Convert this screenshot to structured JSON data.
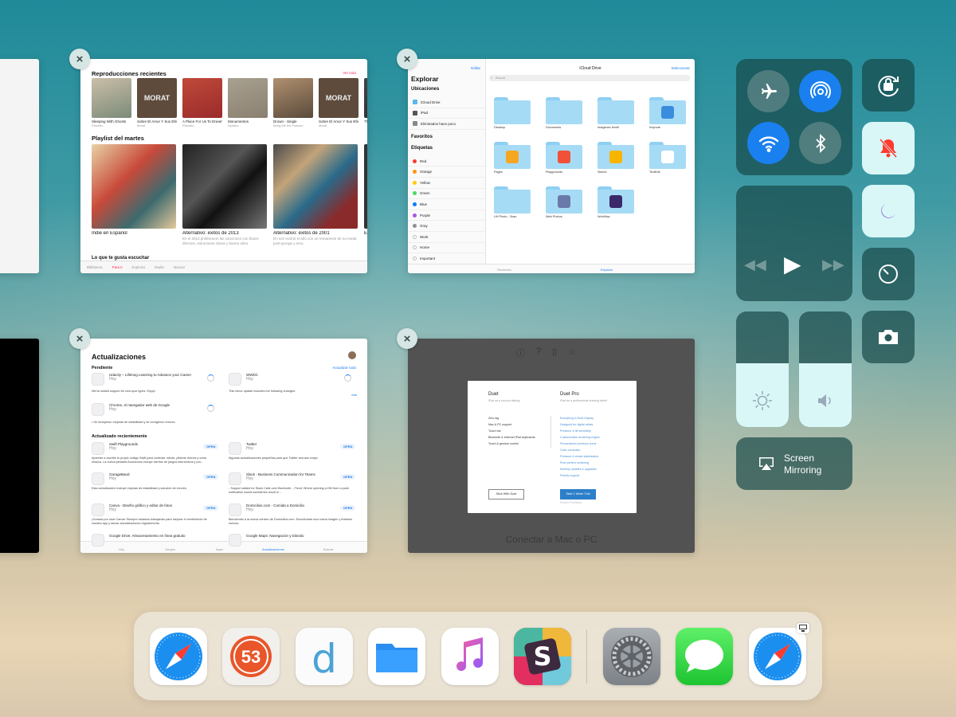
{
  "music": {
    "recent_title": "Reproducciones recientes",
    "see_all": "Ver todo",
    "albums": [
      {
        "name": "Sleeping With Ghosts",
        "artist": "Placebo",
        "color": "#7a8a78",
        "art": "#cbbfa8"
      },
      {
        "name": "Sobre El Amor Y Sus Efe...",
        "artist": "Morat",
        "color": "#6e5a4a",
        "art": "MORAT"
      },
      {
        "name": "A Place For Us To Dream",
        "artist": "Placebo",
        "color": "#9a2b2b",
        "art": "#c04a3a"
      },
      {
        "name": "Monumentos",
        "artist": "Spiritus",
        "color": "#8a8070",
        "art": "#a8a090"
      },
      {
        "name": "Drown - Single",
        "artist": "Bring Me the Horizon",
        "color": "#5a4a3a",
        "art": "#b09070"
      },
      {
        "name": "Sobre El Amor Y Sus Efe...",
        "artist": "Morat",
        "color": "#6e5a4a",
        "art": "MORAT"
      },
      {
        "name": "Th",
        "artist": "",
        "color": "#333",
        "art": "#444"
      }
    ],
    "playlist_title": "Playlist del martes",
    "playlists": [
      {
        "name": "Indie en Español",
        "desc": ""
      },
      {
        "name": "Alternativo: éxitos de 2013",
        "desc": "En el 2013 proliferaron las canciones con títulos directos, estructuras claras y buena vibra."
      },
      {
        "name": "Alternativo: éxitos de 2001",
        "desc": "El rock recibió el año con un remanente de nu-metal, post-grunge y emo."
      },
      {
        "name": "Er",
        "desc": ""
      }
    ],
    "cut_heading": "Lo que te gusta escuchar",
    "tabs": [
      "Biblioteca",
      "Para ti",
      "Explorar",
      "Radio",
      "Buscar"
    ]
  },
  "files": {
    "edit": "Editar",
    "title": "Explorar",
    "header_center": "iCloud Drive",
    "select": "Seleccionar",
    "search_placeholder": "Buscar",
    "locations_title": "Ubicaciones",
    "locations": [
      "iCloud Drive",
      "iPad",
      "Eliminados hace poco"
    ],
    "favorites_title": "Favoritos",
    "tags_title": "Etiquetas",
    "tags": [
      {
        "name": "Red",
        "color": "#ff3b30"
      },
      {
        "name": "Orange",
        "color": "#ff9500"
      },
      {
        "name": "Yellow",
        "color": "#ffcc00"
      },
      {
        "name": "Green",
        "color": "#4cd964"
      },
      {
        "name": "Blue",
        "color": "#007aff"
      },
      {
        "name": "Purple",
        "color": "#af52de"
      },
      {
        "name": "Gray",
        "color": "#8e8e93"
      },
      {
        "name": "Work",
        "color": "#ffffff"
      },
      {
        "name": "Home",
        "color": "#ffffff"
      },
      {
        "name": "Important",
        "color": "#ffffff"
      }
    ],
    "folders": [
      "Desktop",
      "Documents",
      "Imágenes Keeill",
      "Keynote",
      "Pages",
      "Playgrounds",
      "Sketch",
      "TextEdit",
      "UH Photo - Scan",
      "Web Photos",
      "Workflow"
    ],
    "tab_recents": "Recientes",
    "tab_browse": "Explorar"
  },
  "appstore": {
    "title": "Actualizaciones",
    "pending": "Pendiente",
    "update_all": "Actualizar todo",
    "pending_items": [
      {
        "name": "Udacity – Lifelong Learning to Advance your Career",
        "sub": "Hoy"
      },
      {
        "name": "WWDC",
        "sub": "Hoy"
      },
      {
        "name": "Chrome, el navegador web de Google",
        "sub": "Hoy"
      }
    ],
    "note_udacity": "We've added support for new quiz types. Enjoy!",
    "note_wwdc": "This minor update includes the following changes:",
    "more": "más",
    "note_chrome": "• Se incluyeron mejoras de estabilidad y se corrigieron errores.",
    "recent": "Actualizado recientemente",
    "recent_items": [
      {
        "name": "Swift Playgrounds",
        "sub": "Hoy",
        "note": "Aprende a escribir tu propio código Swift para controlar robots, pilotear drones y crear música. La nueva pestaña Accesorios incluye cientos de juegos interactivos y pro..."
      },
      {
        "name": "Twitter",
        "sub": "Hoy",
        "note": "Algunas actualizaciones pequeñas para que Twitter sea aún mejor."
      },
      {
        "name": "GarageBand",
        "sub": "Hoy",
        "note": "Esta actualización incluye mejoras de estabilidad y solución de errores."
      },
      {
        "name": "Slack - Business Communication for Teams",
        "sub": "Hoy",
        "note": "- Support added for Slack Calls over Bluetooth. - Fixed: Where opening a DM from a push notification would sometimes result in ..."
      },
      {
        "name": "Canva - Diseño gráfico y editor de fotos",
        "sub": "Hoy",
        "note": "¡Gracias por usar Canva! Siempre estamos trabajando para mejorar el rendimiento de nuestra app y lanzar actualizaciones regularmente."
      },
      {
        "name": "Domicilios.com - Comida a Domicilio",
        "sub": "Hoy",
        "note": "Bienvenido a la nueva versión de Domicilios.com. Encontrarás una nueva imagen y features nuevos."
      },
      {
        "name": "Google Drive: Almacenamiento en línea gratuito",
        "sub": "",
        "note": ""
      },
      {
        "name": "Google Maps: Navegación y tránsito",
        "sub": "",
        "note": ""
      }
    ],
    "open": "OPEN",
    "tabs": [
      "Hoy",
      "Juegos",
      "Apps",
      "Actualizaciones",
      "Buscar"
    ]
  },
  "duet": {
    "left_title": "Duet",
    "left_sub": "iPad as a second display",
    "right_title": "Duet Pro",
    "right_sub": "iPad as a professional drawing tablet",
    "left_features": [
      "Zero lag",
      "Mac & PC support",
      "Touch bar",
      "Bluetooth & ethernet iPad keyboards",
      "Touch & gesture control"
    ],
    "right_features": [
      "Everything in Duet Display",
      "Designed for digital artists",
      "Pressure & tilt sensitivity",
      "Customizable rendering engine",
      "Personalized pressure curve",
      "Color correction",
      "Pressure & stroke stabilization",
      "Pixel perfect rendering",
      "Monthly updates & upgrades",
      "Priority support"
    ],
    "stick_button": "Stick With Duet",
    "trial_button": "Start 1 Week Trial",
    "restore": "Restore Purchases",
    "bottom_text": "Conectar a Mac o PC"
  },
  "control_center": {
    "screen_mirroring": "Screen\nMirroring",
    "brightness": 0.55,
    "volume": 0.55
  },
  "dock": {
    "apps": [
      "Safari",
      "Fiftythree Paper",
      "Day One",
      "Files",
      "Music",
      "Slack",
      "Settings",
      "Messages",
      "Safari"
    ]
  }
}
